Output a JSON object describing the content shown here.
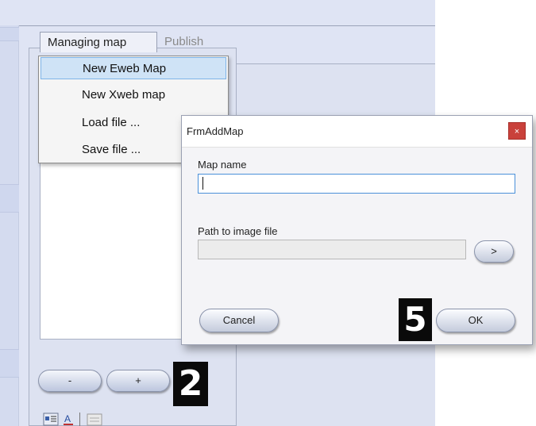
{
  "tabs": [
    {
      "label": "Managing map"
    },
    {
      "label": "Publish"
    }
  ],
  "context_menu": {
    "items": [
      {
        "label": "New Eweb Map",
        "highlighted": true
      },
      {
        "label": "New Xweb map"
      },
      {
        "label": "Load file ..."
      },
      {
        "label": "Save file ..."
      }
    ]
  },
  "bottom_buttons": {
    "minus_label": "-",
    "plus_label": "+"
  },
  "badges": {
    "step_2": "2",
    "step_5": "5"
  },
  "dialog": {
    "title": "FrmAddMap",
    "close_label": "×",
    "map_name_label": "Map name",
    "map_name_value": "",
    "path_label": "Path to image file",
    "path_value": "",
    "browse_label": ">",
    "cancel_label": "Cancel",
    "ok_label": "OK"
  },
  "colors": {
    "app_background": "#dfe4f4",
    "menu_highlight": "#cfe3f6",
    "close_button": "#c9413b",
    "input_focus_border": "#4a90d9",
    "badge": "#0a0a0a"
  }
}
